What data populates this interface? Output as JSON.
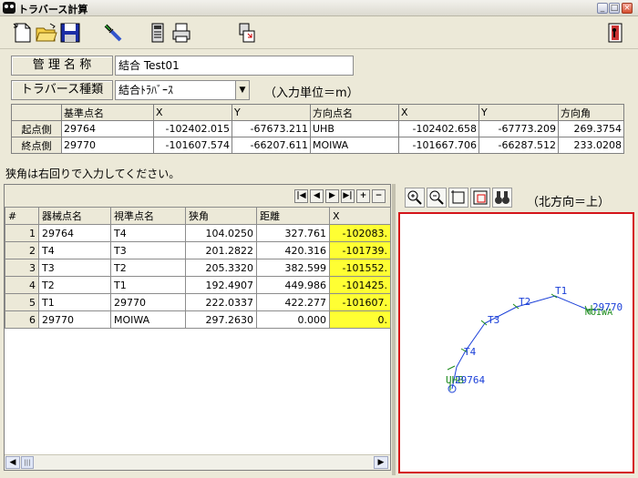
{
  "window": {
    "title": "トラバース計算"
  },
  "form": {
    "name_label": "管 理 名 称",
    "name_value": "結合 Test01",
    "type_label": "トラバース種類",
    "type_value": "結合ﾄﾗﾊﾞｰｽ",
    "unit_note": "（入力単位＝m）"
  },
  "points_table": {
    "headers": [
      "",
      "基準点名",
      "X",
      "Y",
      "方向点名",
      "X",
      "Y",
      "方向角"
    ],
    "rows": [
      {
        "label": "起点側",
        "base": "29764",
        "x": "-102402.015",
        "y": "-67673.211",
        "dir": "UHB",
        "dx": "-102402.658",
        "dy": "-67773.209",
        "angle": "269.3754"
      },
      {
        "label": "終点側",
        "base": "29770",
        "x": "-101607.574",
        "y": "-66207.611",
        "dir": "MOIWA",
        "dx": "-101667.706",
        "dy": "-66287.512",
        "angle": "233.0208"
      }
    ]
  },
  "hint": "狭角は右回りで入力してください。",
  "nav": {
    "first": "|◀",
    "prev": "◀",
    "next": "▶",
    "last": "▶|",
    "add": "+",
    "remove": "−"
  },
  "grid": {
    "headers": [
      "#",
      "器械点名",
      "視準点名",
      "狭角",
      "距離",
      "X"
    ],
    "rows": [
      {
        "n": "1",
        "inst": "29764",
        "target": "T4",
        "angle": "104.0250",
        "dist": "327.761",
        "x": "-102083."
      },
      {
        "n": "2",
        "inst": "T4",
        "target": "T3",
        "angle": "201.2822",
        "dist": "420.316",
        "x": "-101739."
      },
      {
        "n": "3",
        "inst": "T3",
        "target": "T2",
        "angle": "205.3320",
        "dist": "382.599",
        "x": "-101552."
      },
      {
        "n": "4",
        "inst": "T2",
        "target": "T1",
        "angle": "192.4907",
        "dist": "449.986",
        "x": "-101425."
      },
      {
        "n": "5",
        "inst": "T1",
        "target": "29770",
        "angle": "222.0337",
        "dist": "422.277",
        "x": "-101607."
      },
      {
        "n": "6",
        "inst": "29770",
        "target": "MOIWA",
        "angle": "297.2630",
        "dist": "0.000",
        "x": "0."
      }
    ]
  },
  "map": {
    "north_note": "（北方向＝上）",
    "labels": {
      "p29764": "29764",
      "uhb": "UHB",
      "t4": "T4",
      "t3": "T3",
      "t2": "T2",
      "t1": "T1",
      "p29770": "29770",
      "moiwa": "MOIWA"
    }
  },
  "colors": {
    "highlight": "#ffff33",
    "map_border": "#d4141a",
    "traverse_line": "#1a3fd8",
    "label_green": "#1a8a1a"
  }
}
